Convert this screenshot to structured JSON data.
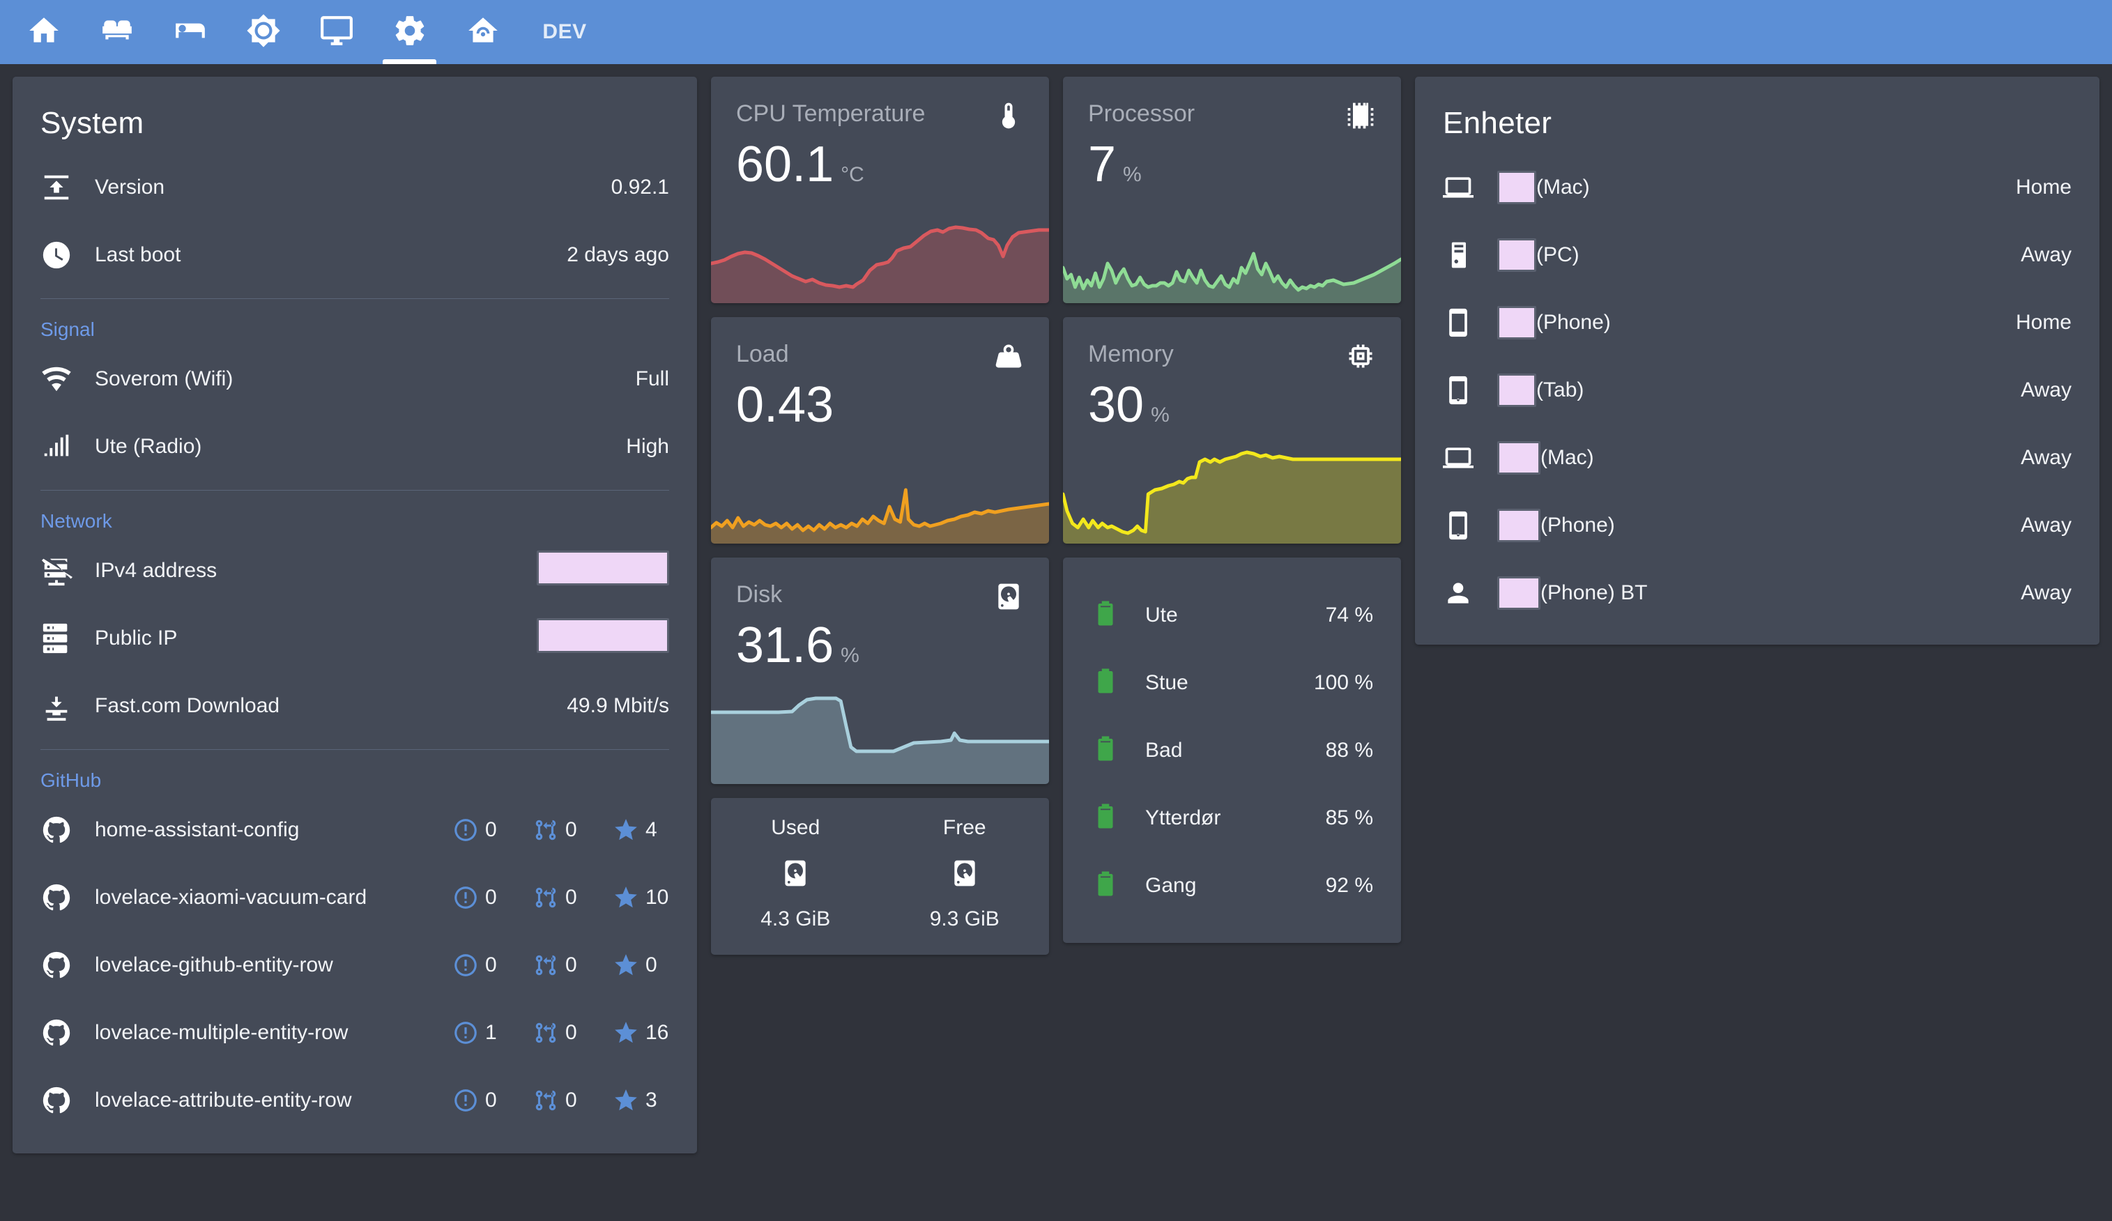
{
  "topbar": {
    "accent_color": "#5c8fd6",
    "tabs": [
      {
        "icon": "home-icon",
        "label": "",
        "active": false
      },
      {
        "icon": "sofa-icon",
        "label": "",
        "active": false
      },
      {
        "icon": "bed-icon",
        "label": "",
        "active": false
      },
      {
        "icon": "brightness-icon",
        "label": "",
        "active": false
      },
      {
        "icon": "monitor-icon",
        "label": "",
        "active": false
      },
      {
        "icon": "gear-icon",
        "label": "",
        "active": true
      },
      {
        "icon": "home-automation-icon",
        "label": "",
        "active": false
      },
      {
        "icon": "dev-text",
        "label": "DEV",
        "active": false
      }
    ]
  },
  "system_card": {
    "title": "System",
    "rows": [
      {
        "icon": "package-up-icon",
        "label": "Version",
        "value": "0.92.1"
      },
      {
        "icon": "clock-icon",
        "label": "Last boot",
        "value": "2 days ago"
      }
    ],
    "signal": {
      "label": "Signal",
      "rows": [
        {
          "icon": "wifi-icon",
          "label": "Soverom (Wifi)",
          "value": "Full"
        },
        {
          "icon": "signal-bars-icon",
          "label": "Ute (Radio)",
          "value": "High"
        }
      ]
    },
    "network": {
      "label": "Network",
      "rows": [
        {
          "icon": "server-off-icon",
          "label": "IPv4 address",
          "value": "",
          "redacted": true
        },
        {
          "icon": "server-network-icon",
          "label": "Public IP",
          "value": "",
          "redacted": true
        },
        {
          "icon": "download-network-icon",
          "label": "Fast.com Download",
          "value": "49.9 Mbit/s",
          "redacted": false
        }
      ]
    },
    "github": {
      "label": "GitHub",
      "stat_color": "#5c8fd6",
      "repos": [
        {
          "icon": "github-icon",
          "name": "home-assistant-config",
          "issues": "0",
          "pulls": "0",
          "stars": "4"
        },
        {
          "icon": "github-icon",
          "name": "lovelace-xiaomi-vacuum-card",
          "issues": "0",
          "pulls": "0",
          "stars": "10"
        },
        {
          "icon": "github-icon",
          "name": "lovelace-github-entity-row",
          "issues": "0",
          "pulls": "0",
          "stars": "0"
        },
        {
          "icon": "github-icon",
          "name": "lovelace-multiple-entity-row",
          "issues": "1",
          "pulls": "0",
          "stars": "16"
        },
        {
          "icon": "github-icon",
          "name": "lovelace-attribute-entity-row",
          "issues": "0",
          "pulls": "0",
          "stars": "3"
        }
      ]
    }
  },
  "sensors": {
    "cpu_temperature": {
      "name": "CPU Temperature",
      "icon": "thermometer-icon",
      "value": "60.1",
      "unit": "°C",
      "color": "#d9595e"
    },
    "processor": {
      "name": "Processor",
      "icon": "chip-icon",
      "value": "7",
      "unit": "%",
      "color": "#8fdc95"
    },
    "load": {
      "name": "Load",
      "icon": "weight-icon",
      "value": "0.43",
      "unit": "",
      "color": "#f0a020"
    },
    "memory": {
      "name": "Memory",
      "icon": "memory-icon",
      "value": "30",
      "unit": "%",
      "color": "#f3e81c"
    },
    "disk": {
      "name": "Disk",
      "icon": "harddisk-icon",
      "value": "31.6",
      "unit": "%",
      "color": "#a9d0dd"
    }
  },
  "disk_usage": {
    "used": {
      "header": "Used",
      "icon": "harddisk-icon",
      "value": "4.3 GiB"
    },
    "free": {
      "header": "Free",
      "icon": "harddisk-icon",
      "value": "9.3 GiB"
    }
  },
  "batteries": {
    "icon_color": "#3fa64a",
    "rows": [
      {
        "icon": "battery-icon",
        "label": "Ute",
        "value": "74 %"
      },
      {
        "icon": "battery-icon",
        "label": "Stue",
        "value": "100 %"
      },
      {
        "icon": "battery-icon",
        "label": "Bad",
        "value": "88 %"
      },
      {
        "icon": "battery-icon",
        "label": "Ytterdør",
        "value": "85 %"
      },
      {
        "icon": "battery-icon",
        "label": "Gang",
        "value": "92 %"
      }
    ]
  },
  "devices_card": {
    "title": "Enheter",
    "rows": [
      {
        "icon": "laptop-icon",
        "name_suffix": "(Mac)",
        "value": "Home",
        "redacted": true,
        "wide": false
      },
      {
        "icon": "desktop-tower-icon",
        "name_suffix": "(PC)",
        "value": "Away",
        "redacted": true,
        "wide": false
      },
      {
        "icon": "cellphone-icon",
        "name_suffix": "(Phone)",
        "value": "Home",
        "redacted": true,
        "wide": false
      },
      {
        "icon": "cellphone-icon",
        "name_suffix": "(Tab)",
        "value": "Away",
        "redacted": true,
        "wide": false
      },
      {
        "icon": "laptop-icon",
        "name_suffix": "(Mac)",
        "value": "Away",
        "redacted": true,
        "wide": true
      },
      {
        "icon": "cellphone-icon",
        "name_suffix": "(Phone)",
        "value": "Away",
        "redacted": true,
        "wide": true
      },
      {
        "icon": "account-icon",
        "name_suffix": "(Phone) BT",
        "value": "Away",
        "redacted": true,
        "wide": true
      }
    ]
  },
  "chart_data": [
    {
      "type": "area",
      "title": "CPU Temperature",
      "ylabel": "°C",
      "current": 60.1,
      "color": "#d9595e",
      "values": [
        48,
        47,
        47,
        48,
        50,
        51,
        50,
        49,
        48,
        47,
        46,
        45,
        44,
        43,
        42,
        43,
        42,
        41,
        41,
        42,
        44,
        45,
        44,
        43,
        43,
        44,
        48,
        52,
        53,
        52,
        54,
        57,
        58,
        58,
        59,
        61,
        62,
        62,
        61,
        62,
        63,
        63,
        62,
        62,
        61,
        60,
        59,
        54,
        52,
        58,
        60
      ]
    },
    {
      "type": "area",
      "title": "Processor",
      "ylabel": "%",
      "current": 7,
      "color": "#8fdc95",
      "values": [
        10,
        6,
        8,
        5,
        9,
        4,
        7,
        6,
        9,
        5,
        8,
        13,
        10,
        6,
        9,
        11,
        7,
        5,
        6,
        8,
        6,
        5,
        6,
        6,
        7,
        7,
        6,
        7,
        10,
        8,
        7,
        11,
        9,
        7,
        11,
        8,
        6,
        5,
        7,
        9,
        6,
        5,
        8,
        7,
        6,
        9,
        12,
        10,
        13,
        11,
        19,
        12,
        9,
        13,
        10,
        7,
        6,
        9,
        7,
        5,
        6,
        5,
        6,
        7,
        6,
        8,
        7,
        9,
        13
      ]
    },
    {
      "type": "area",
      "title": "Load",
      "ylabel": "",
      "current": 0.43,
      "color": "#f0a020",
      "values": [
        0.3,
        0.38,
        0.32,
        0.42,
        0.33,
        0.45,
        0.34,
        0.4,
        0.36,
        0.38,
        0.36,
        0.35,
        0.37,
        0.33,
        0.39,
        0.32,
        0.36,
        0.3,
        0.34,
        0.28,
        0.35,
        0.31,
        0.38,
        0.33,
        0.36,
        0.32,
        0.37,
        0.35,
        0.42,
        0.38,
        0.44,
        0.4,
        0.38,
        0.52,
        0.42,
        0.4,
        0.9,
        0.44,
        0.36,
        0.34,
        0.37,
        0.34,
        0.36,
        0.35,
        0.38,
        0.4,
        0.43
      ]
    },
    {
      "type": "area",
      "title": "Memory",
      "ylabel": "%",
      "current": 30,
      "color": "#f3e81c",
      "values": [
        24,
        18,
        12,
        10,
        15,
        11,
        16,
        12,
        15,
        11,
        12,
        10,
        9,
        8,
        9,
        12,
        10,
        8,
        11,
        26,
        25,
        26,
        27,
        28,
        28,
        29,
        28,
        27,
        29,
        34,
        33,
        34,
        33,
        35,
        34,
        35,
        36,
        36,
        35,
        36,
        35,
        34,
        33
      ]
    },
    {
      "type": "area",
      "title": "Disk",
      "ylabel": "%",
      "current": 31.6,
      "color": "#a9d0dd",
      "values": [
        40,
        40,
        40,
        40,
        40,
        40,
        40,
        40,
        40,
        40,
        41,
        44,
        45,
        45,
        45,
        45,
        45,
        44,
        36,
        31,
        31,
        31,
        31,
        31,
        31,
        31,
        31,
        31,
        32,
        32,
        32,
        32,
        32,
        32,
        35,
        33,
        32,
        32,
        32,
        32,
        32,
        32
      ]
    }
  ]
}
